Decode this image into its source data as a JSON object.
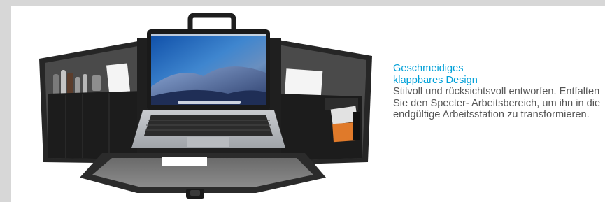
{
  "colors": {
    "page_background": "#d7d7d7",
    "panel_background": "#ffffff",
    "headline": "#00a0d8",
    "body_text": "#555555"
  },
  "product_image": {
    "subject": "laptop-organizer-case",
    "depicts": [
      "laptop",
      "open-folding-organizer",
      "pen-holders",
      "card-pockets",
      "carry-handle",
      "clasp"
    ]
  },
  "feature": {
    "headline": "Geschmeidiges\nklappbares Design",
    "body": "Stilvoll und rücksichtsvoll entworfen. Entfalten Sie den Specter- Arbeitsbereich, um ihn in die endgültige Arbeitsstation zu transformieren."
  }
}
